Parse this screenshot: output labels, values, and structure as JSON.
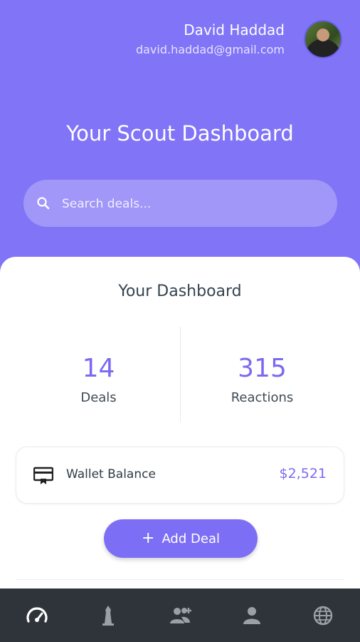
{
  "user": {
    "name": "David Haddad",
    "email": "david.haddad@gmail.com"
  },
  "header": {
    "title": "Your Scout Dashboard"
  },
  "search": {
    "placeholder": "Search deals...",
    "icon": "search-icon"
  },
  "dashboard": {
    "title": "Your Dashboard",
    "stats": [
      {
        "value": "14",
        "label": "Deals"
      },
      {
        "value": "315",
        "label": "Reactions"
      }
    ],
    "wallet": {
      "label": "Wallet Balance",
      "value": "$2,521",
      "icon": "card-icon"
    },
    "add_button": {
      "icon": "+",
      "label": "Add Deal"
    }
  },
  "bottom_nav": {
    "items": [
      {
        "icon": "speedometer-icon"
      },
      {
        "icon": "lighthouse-icon"
      },
      {
        "icon": "add-user-icon"
      },
      {
        "icon": "person-icon"
      },
      {
        "icon": "globe-icon"
      }
    ]
  },
  "colors": {
    "accent": "#7d6ff5",
    "header_bg": "#8174f7",
    "nav_bg": "#2f343a"
  }
}
